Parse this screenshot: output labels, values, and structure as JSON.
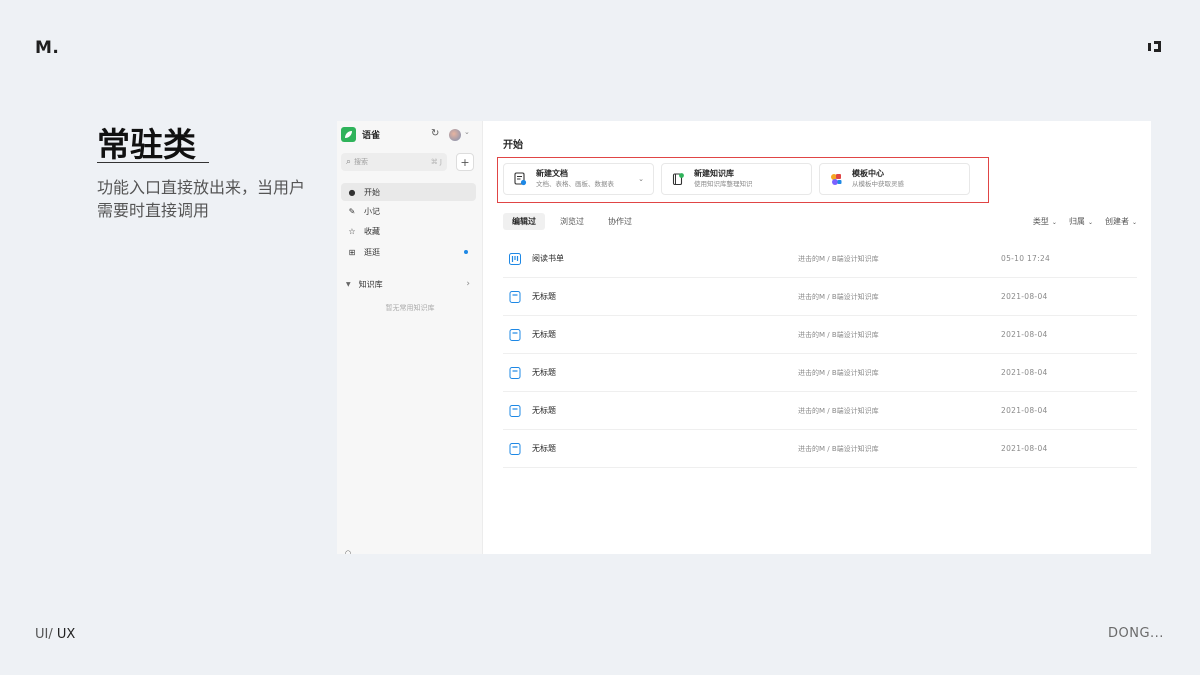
{
  "slide": {
    "logo": "M.",
    "heading": "常驻类",
    "description": "功能入口直接放出来，当用户需要时直接调用",
    "footer_left_prefix": "UI/ ",
    "footer_left_strong": "UX",
    "footer_right": "DONG..."
  },
  "sidebar": {
    "app_name": "语雀",
    "search_placeholder": "搜索",
    "search_shortcut": "⌘ J",
    "add_label": "+",
    "nav": [
      {
        "label": "开始",
        "icon": "clock-icon"
      },
      {
        "label": "小记",
        "icon": "pen-icon"
      },
      {
        "label": "收藏",
        "icon": "star-icon"
      },
      {
        "label": "逛逛",
        "icon": "grid-icon"
      }
    ],
    "knowledge_base_label": "知识库",
    "knowledge_base_empty": "暂无常用知识库"
  },
  "main": {
    "title": "开始",
    "quick_actions": [
      {
        "title": "新建文档",
        "subtitle": "文档、表格、画板、数据表",
        "icon": "new-doc-icon",
        "has_dropdown": true
      },
      {
        "title": "新建知识库",
        "subtitle": "使用知识库整理知识",
        "icon": "new-kb-icon",
        "has_dropdown": false
      },
      {
        "title": "模板中心",
        "subtitle": "从模板中获取灵感",
        "icon": "template-icon",
        "has_dropdown": false
      }
    ],
    "tabs": [
      "编辑过",
      "浏览过",
      "协作过"
    ],
    "active_tab": "编辑过",
    "filters": [
      "类型",
      "归属",
      "创建者"
    ],
    "documents": [
      {
        "name": "阅读书单",
        "location": "进击的M / B端设计知识库",
        "time": "05-10 17:24",
        "icon": "board-icon"
      },
      {
        "name": "无标题",
        "location": "进击的M / B端设计知识库",
        "time": "2021-08-04",
        "icon": "doc-icon"
      },
      {
        "name": "无标题",
        "location": "进击的M / B端设计知识库",
        "time": "2021-08-04",
        "icon": "doc-icon"
      },
      {
        "name": "无标题",
        "location": "进击的M / B端设计知识库",
        "time": "2021-08-04",
        "icon": "doc-icon"
      },
      {
        "name": "无标题",
        "location": "进击的M / B端设计知识库",
        "time": "2021-08-04",
        "icon": "doc-icon"
      },
      {
        "name": "无标题",
        "location": "进击的M / B端设计知识库",
        "time": "2021-08-04",
        "icon": "doc-icon"
      }
    ]
  },
  "colors": {
    "background": "#eef1f5",
    "highlight": "#e04545",
    "brand_green": "#2fb35a",
    "accent_blue": "#1e88e5"
  }
}
